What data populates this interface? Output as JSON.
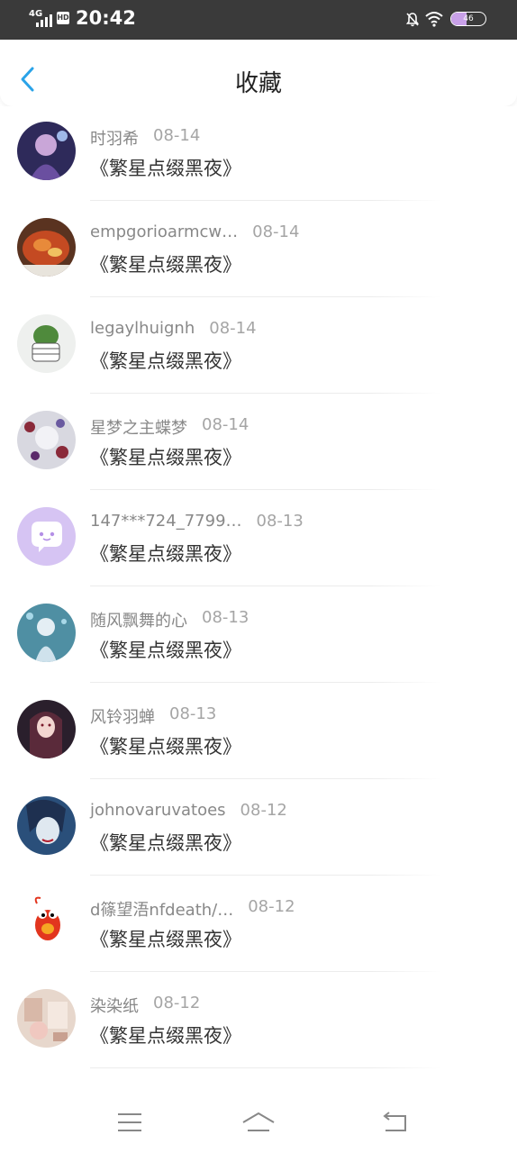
{
  "status_bar": {
    "network": "4G",
    "hd": "HD",
    "time": "20:42",
    "battery": "46",
    "battery_level_percent": 46,
    "icons": [
      "signal-icon",
      "hd-icon",
      "mute-bell-icon",
      "wifi-icon",
      "battery-icon"
    ]
  },
  "header": {
    "title": "收藏",
    "back_icon": "chevron-left-icon",
    "accent_color": "#2aa3e8"
  },
  "items": [
    {
      "name": "时羽希",
      "date": "08-14",
      "work": "《繁星点缀黑夜》"
    },
    {
      "name": "empgorioarmcw…",
      "date": "08-14",
      "work": "《繁星点缀黑夜》"
    },
    {
      "name": "legaylhuignh",
      "date": "08-14",
      "work": "《繁星点缀黑夜》"
    },
    {
      "name": "星梦之主蝶梦",
      "date": "08-14",
      "work": "《繁星点缀黑夜》"
    },
    {
      "name": "147***724_7799…",
      "date": "08-13",
      "work": "《繁星点缀黑夜》"
    },
    {
      "name": "随风飘舞的心",
      "date": "08-13",
      "work": "《繁星点缀黑夜》"
    },
    {
      "name": "风铃羽蝉",
      "date": "08-13",
      "work": "《繁星点缀黑夜》"
    },
    {
      "name": "johnovaruvatoes",
      "date": "08-12",
      "work": "《繁星点缀黑夜》"
    },
    {
      "name": "d篠望浯nfdeath/…",
      "date": "08-12",
      "work": "《繁星点缀黑夜》"
    },
    {
      "name": "染染纸",
      "date": "08-12",
      "work": "《繁星点缀黑夜》"
    }
  ],
  "nav_bar": {
    "icons": [
      "menu-icon",
      "home-icon",
      "back-icon"
    ]
  }
}
